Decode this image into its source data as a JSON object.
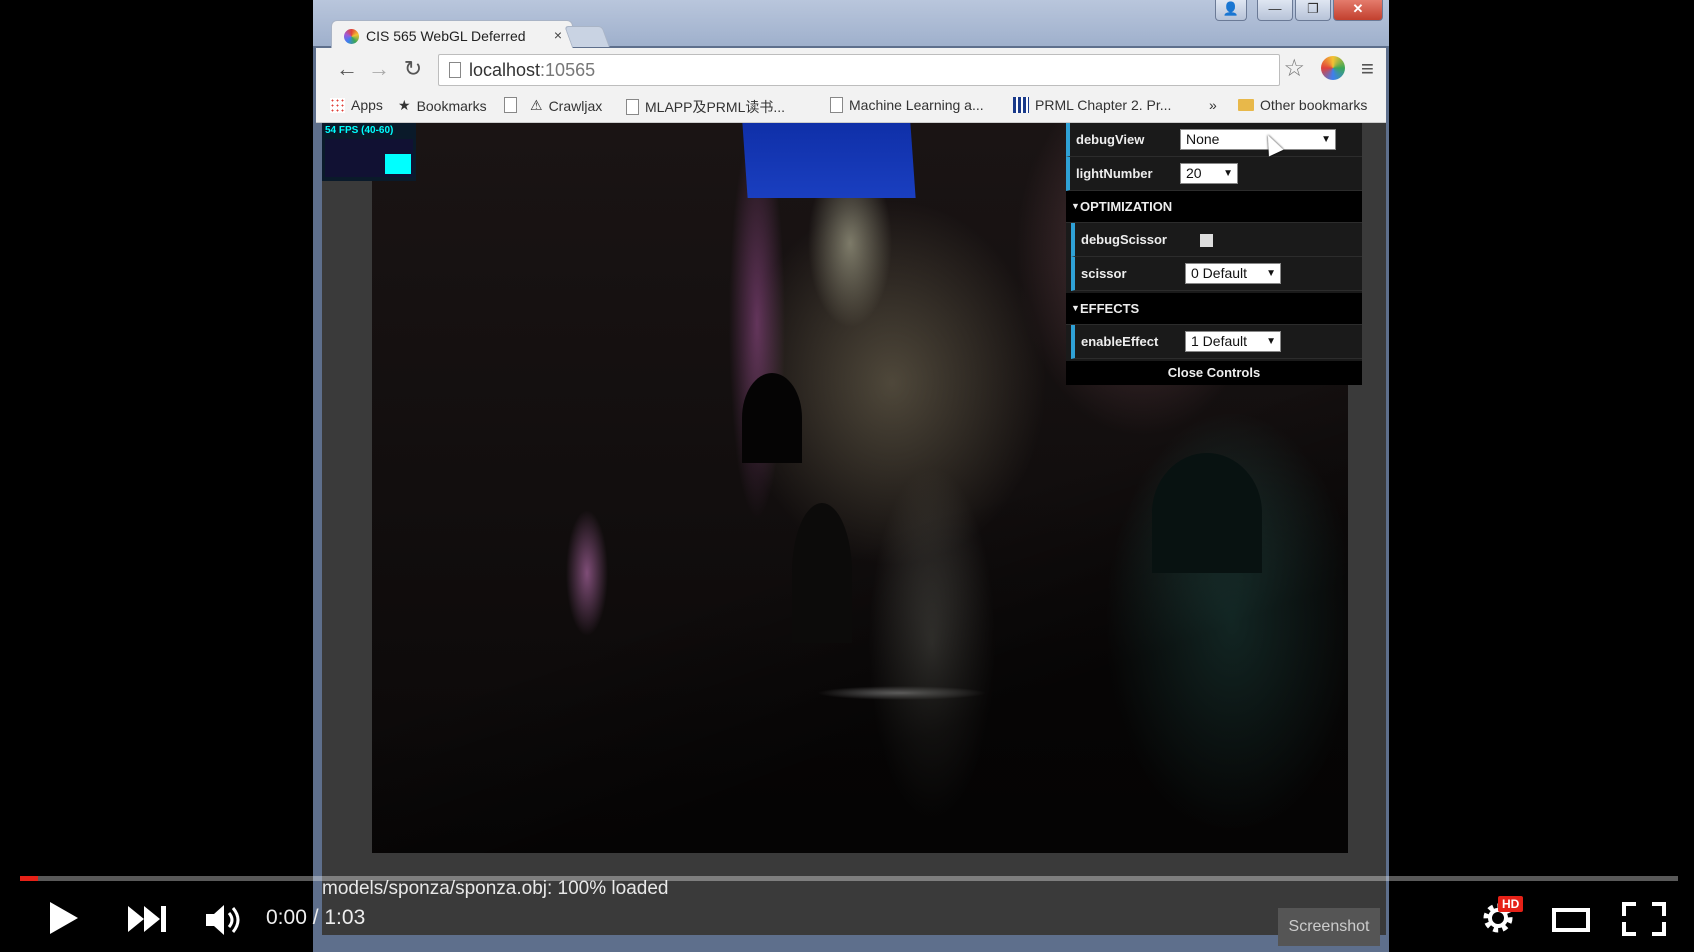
{
  "browser": {
    "tab_title": "CIS 565 WebGL Deferred",
    "tab_close": "×",
    "url_host": "localhost",
    "url_port": ":10565",
    "window_buttons": {
      "minimize": "—",
      "maximize": "❐",
      "close": "✕"
    },
    "bookmarks": [
      {
        "label": "Apps",
        "icon": "apps-icon"
      },
      {
        "label": "Bookmarks",
        "icon": "star-icon"
      },
      {
        "label": "",
        "icon": "page-icon"
      },
      {
        "label": "Crawljax",
        "icon": "crawljax-icon"
      },
      {
        "label": "MLAPP及PRML读书...",
        "icon": "page-icon"
      },
      {
        "label": "Machine Learning a...",
        "icon": "page-icon"
      },
      {
        "label": "PRML Chapter 2. Pr...",
        "icon": "grid-icon"
      }
    ],
    "bookmarks_overflow": "»",
    "other_bookmarks": "Other bookmarks"
  },
  "stats": {
    "fps_text": "54 FPS (40-60)"
  },
  "gui": {
    "debugView": {
      "label": "debugView",
      "value": "None"
    },
    "lightNumber": {
      "label": "lightNumber",
      "value": "20"
    },
    "optimization": {
      "title": "OPTIMIZATION",
      "debugScissor": {
        "label": "debugScissor",
        "checked": false
      },
      "scissor": {
        "label": "scissor",
        "value": "0 Default"
      }
    },
    "effects": {
      "title": "EFFECTS",
      "enableEffect": {
        "label": "enableEffect",
        "value": "1 Default"
      }
    },
    "close_label": "Close Controls"
  },
  "page": {
    "status": "models/sponza/sponza.obj: 100% loaded",
    "screenshot_button": "Screenshot"
  },
  "player": {
    "time": "0:00 / 1:03",
    "progress_fraction": 0.011,
    "hd_badge": "HD",
    "accent_color": "#e62117"
  }
}
